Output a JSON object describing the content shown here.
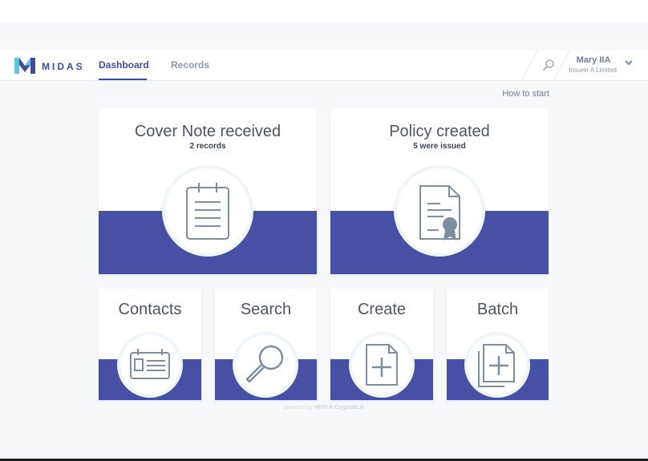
{
  "app": {
    "logo_text": "MIDAS"
  },
  "nav": {
    "dashboard": "Dashboard",
    "records": "Records"
  },
  "user": {
    "name": "Mary IIA",
    "company": "Insurer A Limited"
  },
  "links": {
    "how_to_start": "How to start"
  },
  "cards": {
    "cover_note": {
      "title": "Cover Note received",
      "subtitle": "2 records"
    },
    "policy": {
      "title": "Policy created",
      "subtitle": "5 were issued"
    },
    "contacts": {
      "title": "Contacts"
    },
    "search": {
      "title": "Search"
    },
    "create": {
      "title": "Create"
    },
    "batch": {
      "title": "Batch"
    }
  },
  "footer": {
    "prefix": "powered by",
    "brands": "HKFI & CryptoBLK"
  },
  "colors": {
    "brand": "#3f4e9a",
    "band": "#4650a5",
    "icon": "#7b8fa0"
  },
  "icons": [
    "logo-mark",
    "search-icon",
    "chevron-down-icon",
    "clipboard-icon",
    "certificate-icon",
    "contact-card-icon",
    "magnifier-icon",
    "new-document-icon",
    "document-stack-icon"
  ]
}
